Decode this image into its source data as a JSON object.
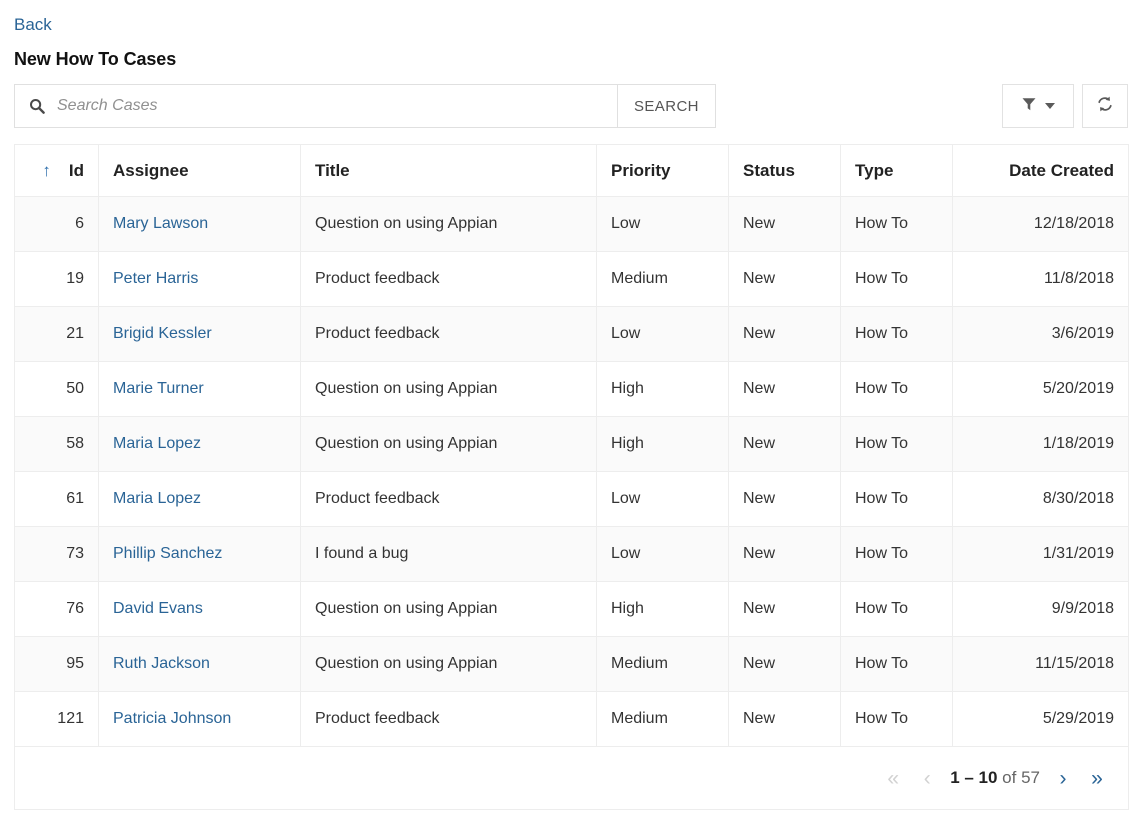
{
  "nav": {
    "back_label": "Back"
  },
  "header": {
    "title": "New How To Cases"
  },
  "toolbar": {
    "search_placeholder": "Search Cases",
    "search_value": "",
    "search_button_label": "SEARCH",
    "filter_icon": "filter-funnel-icon",
    "filter_caret_icon": "chevron-down-icon",
    "refresh_icon": "refresh-icon",
    "search_icon": "search-icon"
  },
  "table": {
    "sort": {
      "column": "Id",
      "direction": "ascending",
      "arrow_glyph": "↑"
    },
    "columns": [
      {
        "key": "id",
        "label": "Id",
        "align": "right"
      },
      {
        "key": "assignee",
        "label": "Assignee",
        "align": "left"
      },
      {
        "key": "title",
        "label": "Title",
        "align": "left"
      },
      {
        "key": "priority",
        "label": "Priority",
        "align": "left"
      },
      {
        "key": "status",
        "label": "Status",
        "align": "left"
      },
      {
        "key": "type",
        "label": "Type",
        "align": "left"
      },
      {
        "key": "date_created",
        "label": "Date Created",
        "align": "right"
      }
    ],
    "rows": [
      {
        "id": "6",
        "assignee": "Mary Lawson",
        "title": "Question on using Appian",
        "priority": "Low",
        "status": "New",
        "type": "How To",
        "date_created": "12/18/2018"
      },
      {
        "id": "19",
        "assignee": "Peter Harris",
        "title": "Product feedback",
        "priority": "Medium",
        "status": "New",
        "type": "How To",
        "date_created": "11/8/2018"
      },
      {
        "id": "21",
        "assignee": "Brigid Kessler",
        "title": "Product feedback",
        "priority": "Low",
        "status": "New",
        "type": "How To",
        "date_created": "3/6/2019"
      },
      {
        "id": "50",
        "assignee": "Marie Turner",
        "title": "Question on using Appian",
        "priority": "High",
        "status": "New",
        "type": "How To",
        "date_created": "5/20/2019"
      },
      {
        "id": "58",
        "assignee": "Maria Lopez",
        "title": "Question on using Appian",
        "priority": "High",
        "status": "New",
        "type": "How To",
        "date_created": "1/18/2019"
      },
      {
        "id": "61",
        "assignee": "Maria Lopez",
        "title": "Product feedback",
        "priority": "Low",
        "status": "New",
        "type": "How To",
        "date_created": "8/30/2018"
      },
      {
        "id": "73",
        "assignee": "Phillip Sanchez",
        "title": "I found a bug",
        "priority": "Low",
        "status": "New",
        "type": "How To",
        "date_created": "1/31/2019"
      },
      {
        "id": "76",
        "assignee": "David Evans",
        "title": "Question on using Appian",
        "priority": "High",
        "status": "New",
        "type": "How To",
        "date_created": "9/9/2018"
      },
      {
        "id": "95",
        "assignee": "Ruth Jackson",
        "title": "Question on using Appian",
        "priority": "Medium",
        "status": "New",
        "type": "How To",
        "date_created": "11/15/2018"
      },
      {
        "id": "121",
        "assignee": "Patricia Johnson",
        "title": "Product feedback",
        "priority": "Medium",
        "status": "New",
        "type": "How To",
        "date_created": "5/29/2019"
      }
    ]
  },
  "pagination": {
    "first_glyph": "«",
    "prev_glyph": "‹",
    "next_glyph": "›",
    "last_glyph": "»",
    "range": "1 – 10",
    "suffix": " of 57",
    "total": "57",
    "first_enabled": false,
    "prev_enabled": false,
    "next_enabled": true,
    "last_enabled": true
  },
  "colors": {
    "link": "#2a6496",
    "sort_arrow": "#2f6fad",
    "border": "#ededed",
    "stripe": "#fafafa",
    "disabled": "#d2d2d2"
  }
}
